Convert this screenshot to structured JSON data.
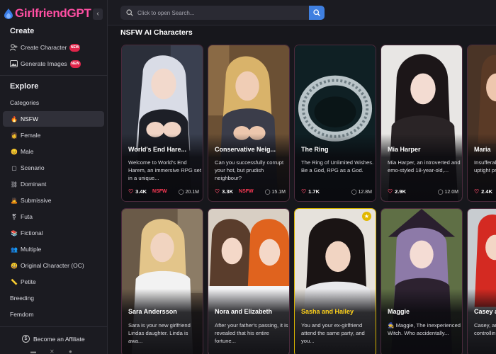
{
  "brand": {
    "name": "GirlfriendGPT"
  },
  "sidebar": {
    "collapse_icon": "‹",
    "create_title": "Create",
    "create_items": [
      {
        "label": "Create Character",
        "icon": "user-plus-icon",
        "badge": "NEW"
      },
      {
        "label": "Generate Images",
        "icon": "image-icon",
        "badge": "NEW"
      }
    ],
    "explore_title": "Explore",
    "categories_label": "Categories",
    "items": [
      {
        "label": "NSFW",
        "glyph": "🔥"
      },
      {
        "label": "Female",
        "glyph": "👩"
      },
      {
        "label": "Male",
        "glyph": "😊"
      },
      {
        "label": "Scenario",
        "glyph": "▢"
      },
      {
        "label": "Dominant",
        "glyph": "⛓"
      },
      {
        "label": "Submissive",
        "glyph": "🙇"
      },
      {
        "label": "Futa",
        "glyph": "⚧"
      },
      {
        "label": "Fictional",
        "glyph": "📚"
      },
      {
        "label": "Multiple",
        "glyph": "👥"
      },
      {
        "label": "Original Character (OC)",
        "glyph": "😃"
      },
      {
        "label": "Petite",
        "glyph": "📏"
      },
      {
        "label": "Breeding",
        "glyph": ""
      },
      {
        "label": "Femdom",
        "glyph": ""
      }
    ],
    "affiliate_label": "Become an Affiliate"
  },
  "search": {
    "placeholder": "Click to open Search..."
  },
  "main": {
    "title": "NSFW AI Characters"
  },
  "cards": [
    {
      "name": "World's End Hare...",
      "desc": "Welcome to World's End Harem, an immersive RPG set in a unique...",
      "likes": "3.4K",
      "tag": "NSFW",
      "chats": "20.1M"
    },
    {
      "name": "Conservative Neig...",
      "desc": "Can you successfully corrupt your hot, but prudish neighbour?",
      "likes": "3.3K",
      "tag": "NSFW",
      "chats": "15.1M"
    },
    {
      "name": "The Ring",
      "desc": "The Ring of Unlimited Wishes. Be a God, RPG as a God.",
      "likes": "1.7K",
      "tag": "",
      "chats": "12.8M"
    },
    {
      "name": "Mia Harper",
      "desc": "Mia Harper, an introverted and emo-styled 18-year-old,...",
      "likes": "2.9K",
      "tag": "",
      "chats": "12.0M"
    },
    {
      "name": "Maria",
      "desc": "Insufferable and judgmental uptight pr...",
      "likes": "2.4K",
      "tag": "",
      "chats": ""
    },
    {
      "name": "Sara Andersson",
      "desc": "Sara is your new girlfriend Lindas daughter. Linda is awa...",
      "likes": "",
      "tag": "",
      "chats": ""
    },
    {
      "name": "Nora and Elizabeth",
      "desc": "After your father's passing, it is revealed that his entire fortune...",
      "likes": "",
      "tag": "",
      "chats": ""
    },
    {
      "name": "Sasha and Hailey",
      "desc": "You and your ex-girlfriend attend the same party, and you...",
      "likes": "",
      "tag": "",
      "chats": ""
    },
    {
      "name": "Maggie",
      "desc": "🧙 Maggie, The inexperienced Witch. Who accidentally...",
      "likes": "",
      "tag": "",
      "chats": ""
    },
    {
      "name": "Casey a...",
      "desc": "Casey, and struggling controllin...",
      "likes": "",
      "tag": "",
      "chats": ""
    }
  ],
  "colors": {
    "brand": "#ff4fa3",
    "accent": "#3f7fe0",
    "badge": "#e0254a",
    "featured": "#d6b200"
  }
}
